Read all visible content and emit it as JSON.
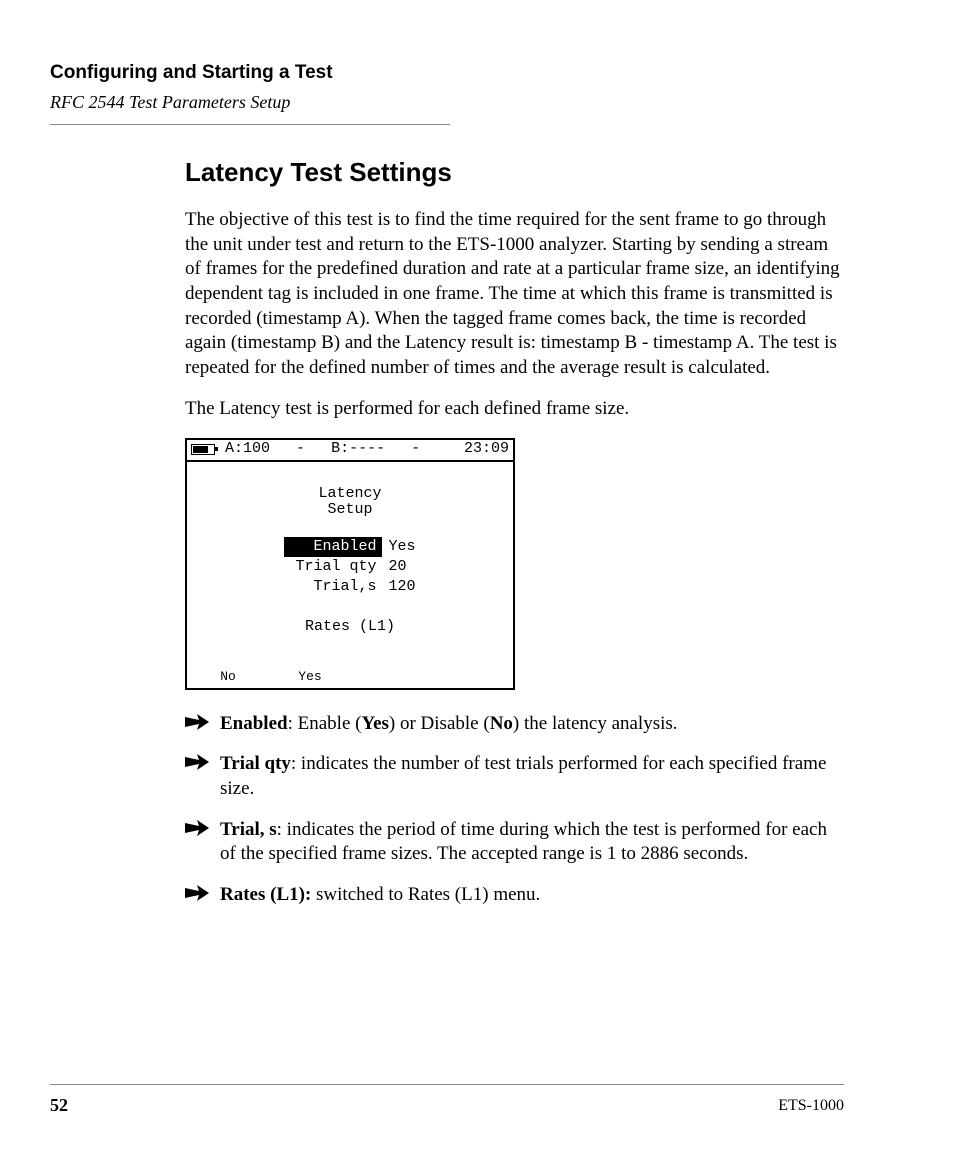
{
  "header": {
    "section": "Configuring and Starting a Test",
    "subsection": "RFC 2544 Test Parameters Setup"
  },
  "heading": "Latency Test Settings",
  "para1": "The objective of this test is to find the time required for the sent frame to go through the unit under test and return to the ETS-1000 analyzer. Starting by sending a stream of frames for the predefined duration and rate at a particular frame size, an identifying dependent tag is included in one frame. The time at which this frame is transmitted is recorded (timestamp A). When the tagged frame comes back, the time is recorded again (timestamp B) and the Latency result is: timestamp B - timestamp A. The test is repeated for the defined number of times and the average result is calculated.",
  "para2": "The Latency test is performed for each defined frame size.",
  "device": {
    "status": {
      "a_label": "A:100",
      "a_dash": "-",
      "b_label": "B:----",
      "b_dash": "-",
      "clock": "23:09"
    },
    "title_line1": "Latency",
    "title_line2": "Setup",
    "params": {
      "enabled_label": "Enabled",
      "enabled_value": "Yes",
      "trialqty_label": "Trial qty",
      "trialqty_value": "20",
      "trials_label": "Trial,s",
      "trials_value": "120"
    },
    "rates": "Rates (L1)",
    "softkeys": {
      "k1": "No",
      "k2": "Yes"
    }
  },
  "bullets": {
    "b1": {
      "term": "Enabled",
      "sep": ": Enable (",
      "yes": "Yes",
      "mid": ") or Disable (",
      "no": "No",
      "tail": ") the latency analysis."
    },
    "b2": {
      "term": "Trial qty",
      "text": ": indicates the number of test trials performed for each specified frame size."
    },
    "b3": {
      "term": "Trial, s",
      "text": ": indicates the period of time during which the test is performed for each of the specified frame sizes. The accepted range is 1 to 2886 seconds."
    },
    "b4": {
      "term": "Rates (L1):",
      "text": " switched to Rates (L1) menu."
    }
  },
  "footer": {
    "page": "52",
    "product": "ETS-1000"
  }
}
